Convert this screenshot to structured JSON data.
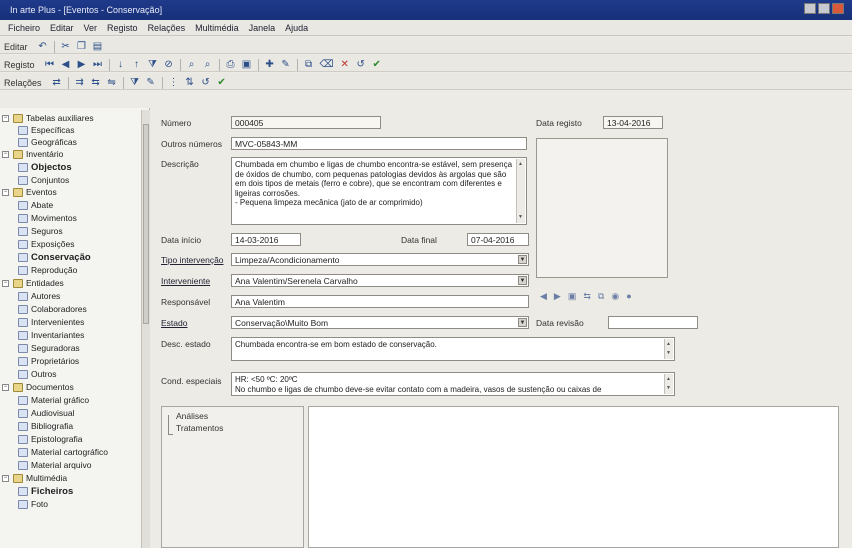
{
  "window": {
    "title": "In arte Plus - [Eventos - Conservação]"
  },
  "menu": [
    "Ficheiro",
    "Editar",
    "Ver",
    "Registo",
    "Relações",
    "Multimédia",
    "Janela",
    "Ajuda"
  ],
  "toolbars": {
    "editar_label": "Editar",
    "registo_label": "Registo",
    "relacoes_label": "Relações"
  },
  "sidebar": {
    "items": [
      {
        "label": "Tabelas auxiliares",
        "level": 0,
        "icon": "folder-icon"
      },
      {
        "label": "Específicas",
        "level": 1,
        "icon": "table-icon"
      },
      {
        "label": "Geográficas",
        "level": 1,
        "icon": "globe-icon"
      },
      {
        "label": "Inventário",
        "level": 0,
        "icon": "folder-icon"
      },
      {
        "label": "Objectos",
        "level": 1,
        "icon": "object-icon",
        "bold": true
      },
      {
        "label": "Conjuntos",
        "level": 1,
        "icon": "set-icon"
      },
      {
        "label": "Eventos",
        "level": 0,
        "icon": "folder-icon"
      },
      {
        "label": "Abate",
        "level": 1,
        "icon": "abate-icon"
      },
      {
        "label": "Movimentos",
        "level": 1,
        "icon": "truck-icon"
      },
      {
        "label": "Seguros",
        "level": 1,
        "icon": "insurance-icon"
      },
      {
        "label": "Exposições",
        "level": 1,
        "icon": "exhibition-icon"
      },
      {
        "label": "Conservação",
        "level": 1,
        "icon": "conservation-icon",
        "bold": true
      },
      {
        "label": "Reprodução",
        "level": 1,
        "icon": "reproduction-icon"
      },
      {
        "label": "Entidades",
        "level": 0,
        "icon": "folder-icon"
      },
      {
        "label": "Autores",
        "level": 1,
        "icon": "author-icon"
      },
      {
        "label": "Colaboradores",
        "level": 1,
        "icon": "collaborator-icon"
      },
      {
        "label": "Intervenientes",
        "level": 1,
        "icon": "participant-icon"
      },
      {
        "label": "Inventariantes",
        "level": 1,
        "icon": "inventory-person-icon"
      },
      {
        "label": "Seguradoras",
        "level": 1,
        "icon": "insurer-icon"
      },
      {
        "label": "Proprietários",
        "level": 1,
        "icon": "owner-icon"
      },
      {
        "label": "Outros",
        "level": 1,
        "icon": "others-icon"
      },
      {
        "label": "Documentos",
        "level": 0,
        "icon": "folder-icon"
      },
      {
        "label": "Material gráfico",
        "level": 1,
        "icon": "graphic-icon"
      },
      {
        "label": "Audiovisual",
        "level": 1,
        "icon": "audiovisual-icon"
      },
      {
        "label": "Bibliografia",
        "level": 1,
        "icon": "book-icon"
      },
      {
        "label": "Epistolografia",
        "level": 1,
        "icon": "letter-icon"
      },
      {
        "label": "Material cartográfico",
        "level": 1,
        "icon": "map-icon"
      },
      {
        "label": "Material arquivo",
        "level": 1,
        "icon": "archive-icon"
      },
      {
        "label": "Multimédia",
        "level": 0,
        "icon": "folder-icon"
      },
      {
        "label": "Ficheiros",
        "level": 1,
        "icon": "files-icon",
        "bold": true
      },
      {
        "label": "Foto",
        "level": 1,
        "icon": "photo-icon"
      }
    ]
  },
  "form": {
    "numero_label": "Número",
    "numero": "000405",
    "data_registo_label": "Data registo",
    "data_registo": "13-04-2016",
    "outros_numeros_label": "Outros números",
    "outros_numeros": "MVC-05843-MM",
    "descricao_label": "Descrição",
    "descricao": "Chumbada em chumbo e ligas de chumbo encontra-se estável, sem presença de óxidos de chumbo, com pequenas patologias devidos às argolas que são em dois tipos de metais (ferro e cobre), que se encontram com diferentes e ligeiras corrosões.\n- Pequena limpeza mecânica (jato de ar comprimido)",
    "data_inicio_label": "Data início",
    "data_inicio": "14-03-2016",
    "data_final_label": "Data final",
    "data_final": "07-04-2016",
    "tipo_intervencao_label": "Tipo intervenção",
    "tipo_intervencao": "Limpeza/Acondicionamento",
    "interveniente_label": "Interveniente",
    "interveniente": "Ana Valentim/Serenela Carvalho",
    "responsavel_label": "Responsável",
    "responsavel": "Ana Valentim",
    "estado_label": "Estado",
    "estado": "Conservação\\Muito Bom",
    "data_revisao_label": "Data revisão",
    "data_revisao": "",
    "desc_estado_label": "Desc. estado",
    "desc_estado": "Chumbada encontra-se em bom estado de conservação.",
    "cond_especiais_label": "Cond. especiais",
    "cond_especiais": "HR: <50 ºC: 20ºC\nNo chumbo e ligas de chumbo deve-se evitar contato com a madeira, vasos de sustenção ou caixas de"
  },
  "subtree": {
    "analises": "Análises",
    "tratamentos": "Tratamentos"
  }
}
